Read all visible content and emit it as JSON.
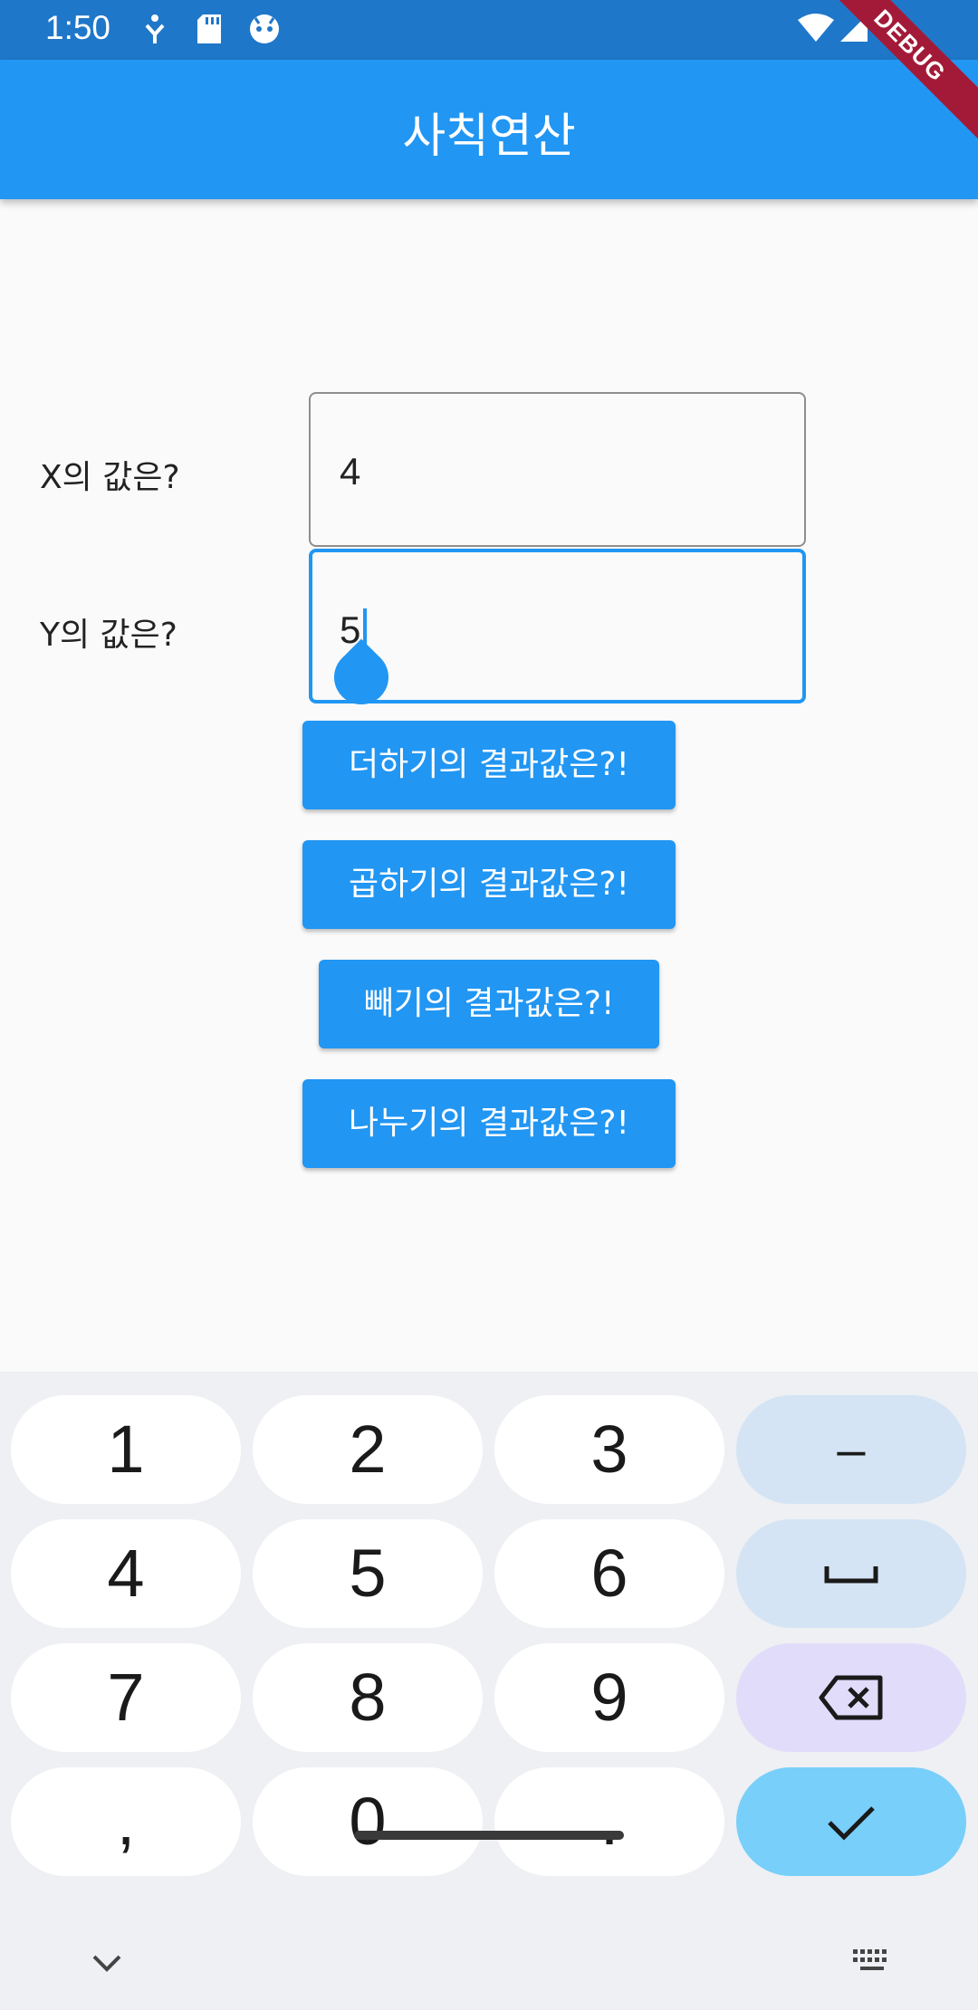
{
  "status_bar": {
    "time": "1:50"
  },
  "debug_banner": "DEBUG",
  "app_bar": {
    "title": "사칙연산"
  },
  "form": {
    "x_label": "X의 값은?",
    "x_value": "4",
    "y_label": "Y의 값은?",
    "y_value": "5"
  },
  "buttons": {
    "add": "더하기의 결과값은?!",
    "multiply": "곱하기의 결과값은?!",
    "subtract": "빼기의 결과값은?!",
    "divide": "나누기의 결과값은?!"
  },
  "keyboard": {
    "keys": [
      "1",
      "2",
      "3",
      "–",
      "4",
      "5",
      "6",
      "7",
      "8",
      "9",
      ",",
      "0",
      "."
    ]
  },
  "colors": {
    "primary": "#2196f3",
    "status_bar": "#1f77c9",
    "keyboard_bg": "#eff0f3",
    "key_function": "#d4e4f4",
    "key_delete": "#e2dcfb",
    "key_enter": "#78cffa"
  },
  "icons": [
    "wifi-icon",
    "signal-icon",
    "sd-card-icon",
    "accessibility-icon",
    "app-notification-icon",
    "backspace-icon",
    "check-icon",
    "space-icon",
    "chevron-down-icon",
    "keyboard-icon"
  ]
}
